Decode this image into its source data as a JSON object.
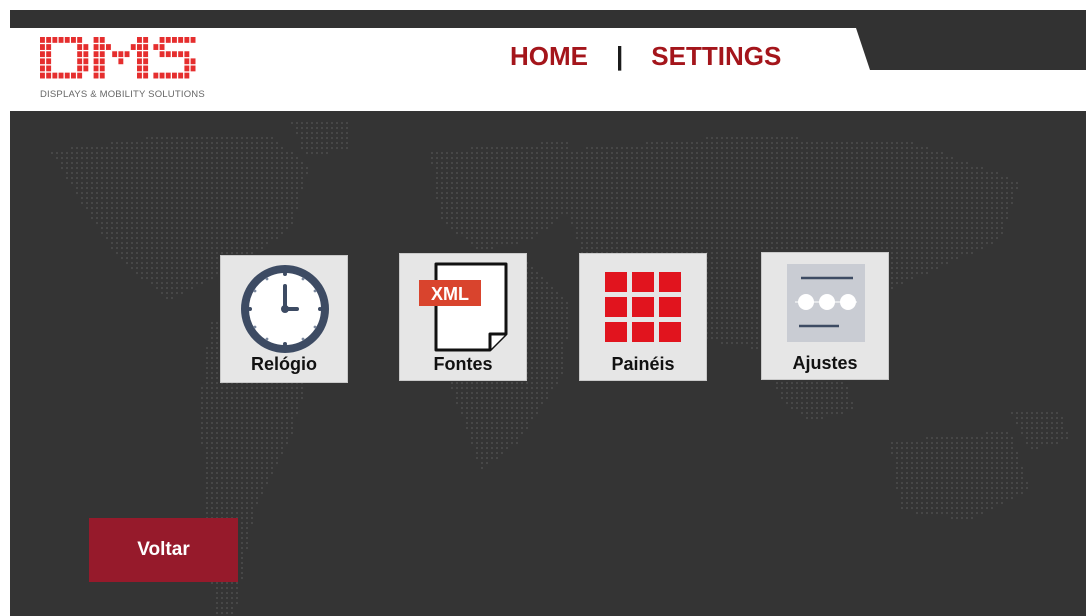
{
  "brand": {
    "logo_text": "DMS",
    "tagline": "DISPLAYS & MOBILITY SOLUTIONS",
    "color": "#e52e2e"
  },
  "nav": {
    "home": "HOME",
    "separator": "|",
    "settings": "SETTINGS",
    "color": "#a4151b"
  },
  "tiles": [
    {
      "label": "Relógio",
      "icon": "clock-icon"
    },
    {
      "label": "Fontes",
      "icon": "xml-file-icon",
      "badge": "XML"
    },
    {
      "label": "Painéis",
      "icon": "grid-panels-icon"
    },
    {
      "label": "Ajustes",
      "icon": "settings-slider-icon"
    }
  ],
  "actions": {
    "back_label": "Voltar",
    "back_color": "#961a2b"
  },
  "theme": {
    "background": "#343434",
    "map_dot_color": "#4a4a4a"
  }
}
